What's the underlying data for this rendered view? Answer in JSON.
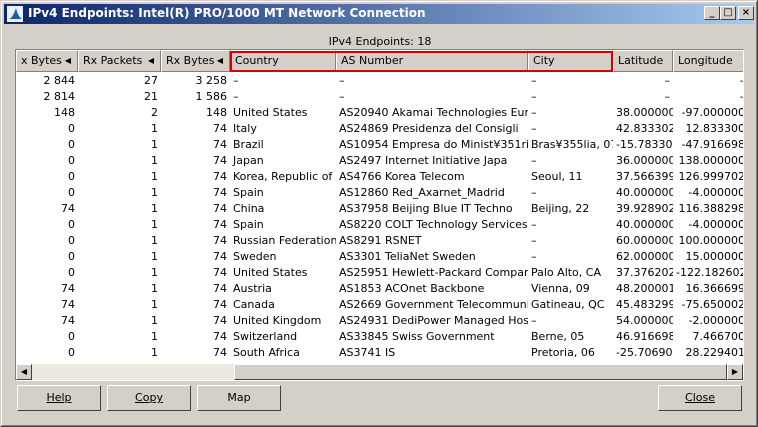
{
  "window": {
    "title": "IPv4 Endpoints: Intel(R) PRO/1000 MT Network Connection"
  },
  "caption": "IPv4 Endpoints: 18",
  "columns": [
    "x Bytes",
    "Rx Packets",
    "Rx Bytes",
    "Country",
    "AS Number",
    "City",
    "Latitude",
    "Longitude"
  ],
  "rows": [
    [
      "2 844",
      "27",
      "3 258",
      "–",
      "–",
      "–",
      "–",
      "–"
    ],
    [
      "2 814",
      "21",
      "1 586",
      "–",
      "–",
      "–",
      "–",
      "–"
    ],
    [
      "148",
      "2",
      "148",
      "United States",
      "AS20940 Akamai Technologies Eur",
      "–",
      "38.000000",
      "-97.000000"
    ],
    [
      "0",
      "1",
      "74",
      "Italy",
      "AS24869 Presidenza del Consigli",
      "–",
      "42.833302",
      "12.833300"
    ],
    [
      "0",
      "1",
      "74",
      "Brazil",
      "AS10954 Empresa do Minist¥351ri",
      "Bras¥355lia, 07",
      "-15.783300",
      "-47.916698"
    ],
    [
      "0",
      "1",
      "74",
      "Japan",
      "AS2497 Internet Initiative Japa",
      "–",
      "36.000000",
      "138.000000"
    ],
    [
      "0",
      "1",
      "74",
      "Korea, Republic of",
      "AS4766 Korea Telecom",
      "Seoul, 11",
      "37.566399",
      "126.999702"
    ],
    [
      "0",
      "1",
      "74",
      "Spain",
      "AS12860 Red_Axarnet_Madrid",
      "–",
      "40.000000",
      "-4.000000"
    ],
    [
      "74",
      "1",
      "74",
      "China",
      "AS37958 Beijing Blue IT Techno",
      "Beijing, 22",
      "39.928902",
      "116.388298"
    ],
    [
      "0",
      "1",
      "74",
      "Spain",
      "AS8220 COLT Technology Services",
      "–",
      "40.000000",
      "-4.000000"
    ],
    [
      "0",
      "1",
      "74",
      "Russian Federation",
      "AS8291 RSNET",
      "–",
      "60.000000",
      "100.000000"
    ],
    [
      "0",
      "1",
      "74",
      "Sweden",
      "AS3301 TeliaNet Sweden",
      "–",
      "62.000000",
      "15.000000"
    ],
    [
      "0",
      "1",
      "74",
      "United States",
      "AS25951 Hewlett-Packard Company",
      "Palo Alto, CA",
      "37.376202",
      "-122.182602"
    ],
    [
      "74",
      "1",
      "74",
      "Austria",
      "AS1853 ACOnet Backbone",
      "Vienna, 09",
      "48.200001",
      "16.366699"
    ],
    [
      "74",
      "1",
      "74",
      "Canada",
      "AS2669 Government Telecommunica",
      "Gatineau, QC",
      "45.483299",
      "-75.650002"
    ],
    [
      "74",
      "1",
      "74",
      "United Kingdom",
      "AS24931 DediPower Managed Hosti",
      "–",
      "54.000000",
      "-2.000000"
    ],
    [
      "0",
      "1",
      "74",
      "Switzerland",
      "AS33845 Swiss Government",
      "Berne, 05",
      "46.916698",
      "7.466700"
    ],
    [
      "0",
      "1",
      "74",
      "South Africa",
      "AS3741 IS",
      "Pretoria, 06",
      "-25.706900",
      "28.229401"
    ]
  ],
  "buttons": {
    "help": "Help",
    "copy": "Copy",
    "map": "Map",
    "close": "Close"
  },
  "icons": {
    "app": "wireshark-fin-icon",
    "sort": "sort-arrow-left-icon"
  },
  "colors": {
    "title_start": "#0a246a",
    "title_end": "#a6caf0",
    "highlight": "#d40000",
    "face": "#d4d0c8"
  }
}
